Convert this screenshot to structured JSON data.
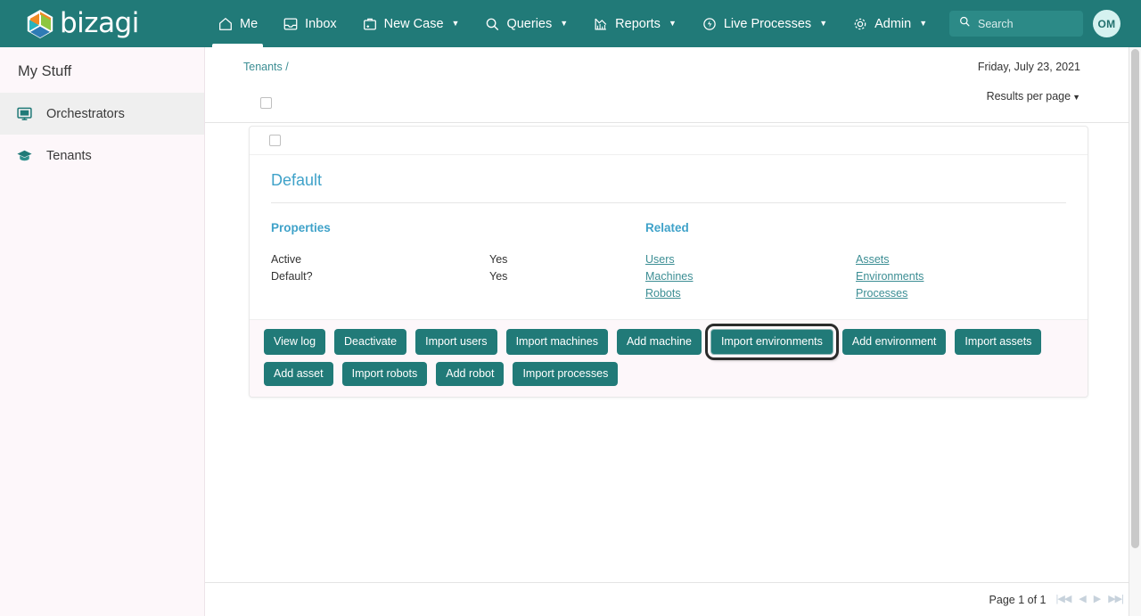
{
  "brand": {
    "name": "bizagi",
    "logo_colors": [
      "#F08A24",
      "#8DC63F",
      "#27B3C0",
      "#2E7BB5"
    ]
  },
  "topnav": {
    "items": [
      {
        "label": "Me",
        "icon": "home-icon",
        "active": true,
        "caret": false
      },
      {
        "label": "Inbox",
        "icon": "inbox-icon",
        "active": false,
        "caret": false
      },
      {
        "label": "New Case",
        "icon": "new-case-icon",
        "active": false,
        "caret": true
      },
      {
        "label": "Queries",
        "icon": "search-icon",
        "active": false,
        "caret": true
      },
      {
        "label": "Reports",
        "icon": "reports-icon",
        "active": false,
        "caret": true
      },
      {
        "label": "Live Processes",
        "icon": "live-processes-icon",
        "active": false,
        "caret": true
      },
      {
        "label": "Admin",
        "icon": "gear-icon",
        "active": false,
        "caret": true
      }
    ],
    "search": {
      "placeholder": "Search",
      "value": ""
    },
    "avatar": {
      "initials": "OM"
    }
  },
  "sidebar": {
    "title": "My Stuff",
    "items": [
      {
        "label": "Orchestrators",
        "icon": "monitor-icon",
        "selected": true
      },
      {
        "label": "Tenants",
        "icon": "graduation-cap-icon",
        "selected": false
      }
    ]
  },
  "main": {
    "breadcrumb": "Tenants /",
    "date": "Friday, July 23, 2021",
    "results_per_page": "Results per page",
    "card": {
      "title": "Default",
      "properties": {
        "heading": "Properties",
        "rows": [
          {
            "key": "Active",
            "value": "Yes"
          },
          {
            "key": "Default?",
            "value": "Yes"
          }
        ]
      },
      "related": {
        "heading": "Related",
        "column_left": [
          "Users",
          "Machines",
          "Robots"
        ],
        "column_right": [
          "Assets",
          "Environments",
          "Processes"
        ]
      },
      "actions": [
        {
          "label": "View log",
          "focused": false
        },
        {
          "label": "Deactivate",
          "focused": false
        },
        {
          "label": "Import users",
          "focused": false
        },
        {
          "label": "Import machines",
          "focused": false
        },
        {
          "label": "Add machine",
          "focused": false
        },
        {
          "label": "Import environments",
          "focused": true
        },
        {
          "label": "Add environment",
          "focused": false
        },
        {
          "label": "Import assets",
          "focused": false
        },
        {
          "label": "Add asset",
          "focused": false
        },
        {
          "label": "Import robots",
          "focused": false
        },
        {
          "label": "Add robot",
          "focused": false
        },
        {
          "label": "Import processes",
          "focused": false
        }
      ]
    }
  },
  "footer": {
    "page_label": "Page 1 of 1",
    "pager": [
      "first-page-icon",
      "prev-page-icon",
      "next-page-icon",
      "last-page-icon"
    ]
  },
  "colors": {
    "brand_teal": "#217A78",
    "link_teal": "#3C8E94",
    "title_blue": "#3FA2C9",
    "sidebar_bg": "#FDF7FA"
  }
}
